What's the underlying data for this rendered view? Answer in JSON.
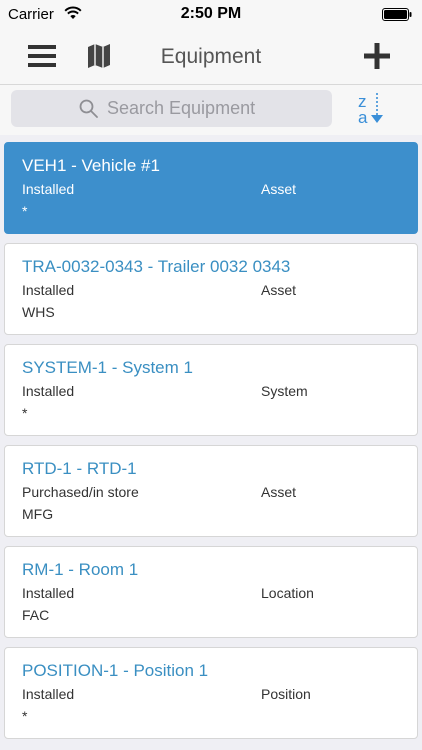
{
  "status_bar": {
    "carrier": "Carrier",
    "time": "2:50 PM"
  },
  "nav": {
    "title": "Equipment",
    "left_icons": [
      "menu-icon",
      "map-icon"
    ],
    "right_icon": "add-icon"
  },
  "search": {
    "placeholder": "Search Equipment",
    "value": ""
  },
  "sort": {
    "letter_top": "z",
    "letter_bottom": "a",
    "icon": "sort-descending-icon"
  },
  "colors": {
    "accent": "#3a8fc2",
    "selected_background": "#3d8fcc"
  },
  "equipment": [
    {
      "title": "VEH1 -  Vehicle #1",
      "status": "Installed",
      "type": "Asset",
      "location": "*",
      "selected": true
    },
    {
      "title": "TRA-0032-0343 -  Trailer 0032 0343",
      "status": "Installed",
      "type": "Asset",
      "location": "WHS",
      "selected": false
    },
    {
      "title": "SYSTEM-1 -  System 1",
      "status": "Installed",
      "type": "System",
      "location": "*",
      "selected": false
    },
    {
      "title": "RTD-1 -  RTD-1",
      "status": "Purchased/in store",
      "type": "Asset",
      "location": "MFG",
      "selected": false
    },
    {
      "title": "RM-1 -  Room 1",
      "status": "Installed",
      "type": "Location",
      "location": "FAC",
      "selected": false
    },
    {
      "title": "POSITION-1 -  Position 1",
      "status": "Installed",
      "type": "Position",
      "location": "*",
      "selected": false
    }
  ]
}
